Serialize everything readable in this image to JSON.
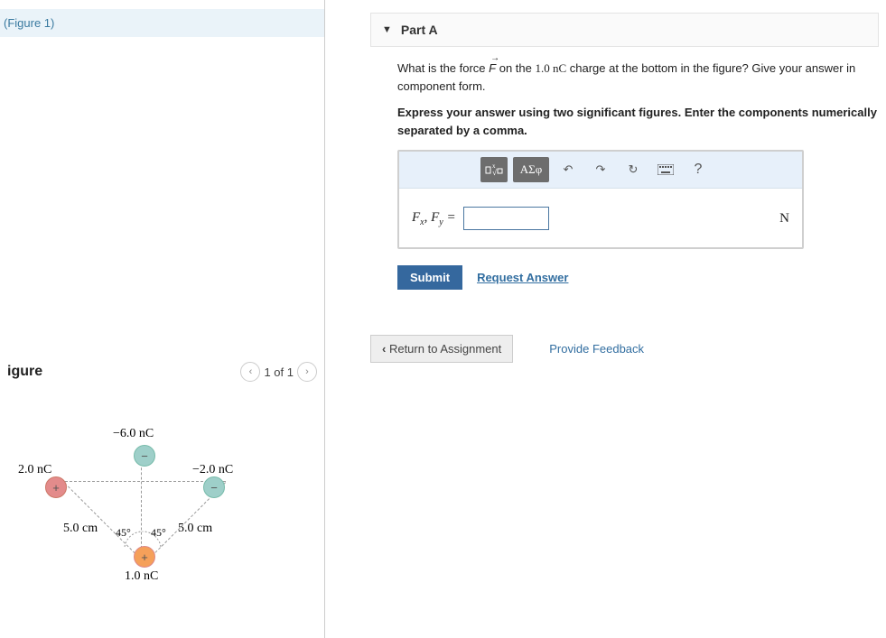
{
  "left": {
    "figure_link": "(Figure 1)",
    "figure_title": "igure",
    "pager_label": "1 of 1",
    "diagram": {
      "top_charge": "−6.0 nC",
      "left_charge": "2.0 nC",
      "right_charge": "−2.0 nC",
      "bottom_charge": "1.0 nC",
      "left_dist": "5.0 cm",
      "right_dist": "5.0 cm",
      "angle_left": "45°",
      "angle_right": "45°"
    }
  },
  "part": {
    "title": "Part A",
    "question_pre": "What is the force ",
    "question_mid": " on the ",
    "question_val": "1.0 nC",
    "question_post": " charge at the bottom in the figure? Give your answer in component form.",
    "instructions": "Express your answer using two significant figures. Enter the components numerically separated by a comma.",
    "greek_label": "ΑΣφ",
    "help_label": "?",
    "answer_unit": "N",
    "submit": "Submit",
    "request": "Request Answer"
  },
  "footer": {
    "return": "Return to Assignment",
    "feedback": "Provide Feedback"
  }
}
